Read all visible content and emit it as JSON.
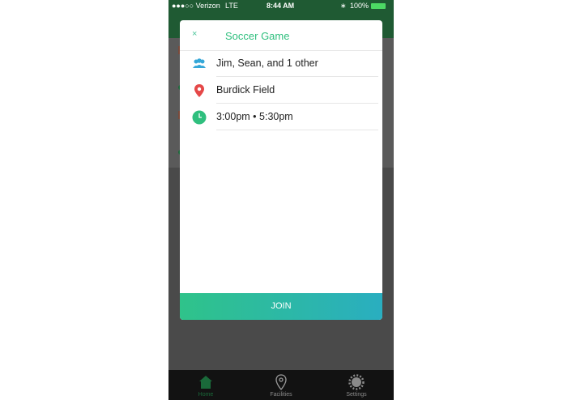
{
  "statusbar": {
    "carrier": "●●●○○ Verizon",
    "network": "LTE",
    "time": "8:44 AM",
    "battery_text": "100%"
  },
  "modal": {
    "close_glyph": "×",
    "title": "Soccer Game",
    "rows": [
      {
        "icon": "people-icon",
        "text": "Jim, Sean, and 1 other",
        "icon_color": "#35a7d8"
      },
      {
        "icon": "location-pin-icon",
        "text": "Burdick Field",
        "icon_color": "#e54848"
      },
      {
        "icon": "clock-icon",
        "text": "3:00pm • 5:30pm",
        "icon_color": "#2fbf7e"
      }
    ],
    "join_label": "JOIN"
  },
  "tabbar": {
    "tabs": [
      {
        "label": "Home",
        "icon": "home-icon",
        "active": true
      },
      {
        "label": "Facilities",
        "icon": "map-pin-icon",
        "active": false
      },
      {
        "label": "Settings",
        "icon": "gear-icon",
        "active": false
      }
    ]
  },
  "colors": {
    "brand_green": "#2fbf7e",
    "header_green": "#1f5a33",
    "join_gradient_start": "#2fc38a",
    "join_gradient_end": "#2aaec0"
  }
}
